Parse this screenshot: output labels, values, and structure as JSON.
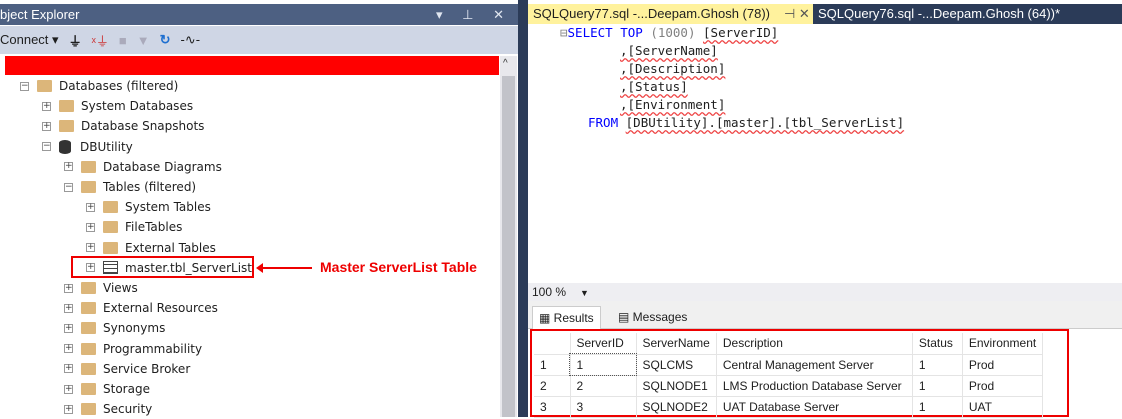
{
  "object_explorer": {
    "title": "bject Explorer",
    "title_controls": "▾ ⊥ ✕",
    "toolbar": {
      "connect_label": "Connect ▾"
    },
    "tree": [
      {
        "label": "Databases (filtered)",
        "level": 1,
        "expanded": true,
        "icon": "folder"
      },
      {
        "label": "System Databases",
        "level": 2,
        "expanded": false,
        "icon": "folder"
      },
      {
        "label": "Database Snapshots",
        "level": 2,
        "expanded": false,
        "icon": "folder"
      },
      {
        "label": "DBUtility",
        "level": 2,
        "expanded": true,
        "icon": "database"
      },
      {
        "label": "Database Diagrams",
        "level": 3,
        "expanded": false,
        "icon": "folder"
      },
      {
        "label": "Tables (filtered)",
        "level": 3,
        "expanded": true,
        "icon": "folder"
      },
      {
        "label": "System Tables",
        "level": 4,
        "expanded": false,
        "icon": "folder"
      },
      {
        "label": "FileTables",
        "level": 4,
        "expanded": false,
        "icon": "folder"
      },
      {
        "label": "External Tables",
        "level": 4,
        "expanded": false,
        "icon": "folder"
      },
      {
        "label": "master.tbl_ServerList",
        "level": 4,
        "expanded": false,
        "icon": "table"
      },
      {
        "label": "Views",
        "level": 3,
        "expanded": false,
        "icon": "folder"
      },
      {
        "label": "External Resources",
        "level": 3,
        "expanded": false,
        "icon": "folder"
      },
      {
        "label": "Synonyms",
        "level": 3,
        "expanded": false,
        "icon": "folder"
      },
      {
        "label": "Programmability",
        "level": 3,
        "expanded": false,
        "icon": "folder"
      },
      {
        "label": "Service Broker",
        "level": 3,
        "expanded": false,
        "icon": "folder"
      },
      {
        "label": "Storage",
        "level": 3,
        "expanded": false,
        "icon": "folder"
      },
      {
        "label": "Security",
        "level": 3,
        "expanded": false,
        "icon": "folder"
      }
    ]
  },
  "annotation": "Master ServerList Table",
  "tabs": [
    {
      "label": "SQLQuery77.sql -...Deepam.Ghosh (78))",
      "pin": "⊣ ✕"
    },
    {
      "label": "SQLQuery76.sql -...Deepam.Ghosh (64))*"
    }
  ],
  "code": {
    "l1_kw": "SELECT TOP",
    "l1_num": "(1000)",
    "l1_col": "[ServerID]",
    "cols": [
      ",[ServerName]",
      ",[Description]",
      ",[Status]",
      ",[Environment]"
    ],
    "from_kw": "FROM",
    "from_obj": "[DBUtility].[master].[tbl_ServerList]"
  },
  "zoom": "100 %",
  "results_tabs": {
    "results": "Results",
    "messages": "Messages"
  },
  "grid": {
    "headers": [
      "",
      "ServerID",
      "ServerName",
      "Description",
      "Status",
      "Environment"
    ],
    "rows": [
      [
        "1",
        "1",
        "SQLCMS",
        "Central Management Server",
        "1",
        "Prod"
      ],
      [
        "2",
        "2",
        "SQLNODE1",
        "LMS Production Database Server",
        "1",
        "Prod"
      ],
      [
        "3",
        "3",
        "SQLNODE2",
        "UAT Database Server",
        "1",
        "UAT"
      ]
    ]
  },
  "colors": {
    "title_bar": "#4d6082",
    "active_tab": "#fff29d",
    "inactive_tab": "#2b3b58",
    "highlight": "#e00000"
  }
}
